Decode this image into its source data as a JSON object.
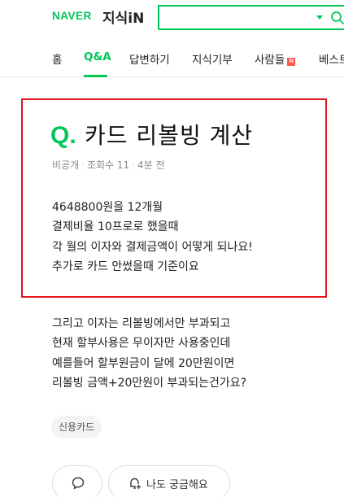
{
  "header": {
    "brand": "NAVER",
    "service": "지식iN",
    "search": {
      "value": "",
      "placeholder": ""
    }
  },
  "nav": {
    "items": [
      {
        "label": "홈"
      },
      {
        "label": "Q&A",
        "active": true
      },
      {
        "label": "답변하기"
      },
      {
        "label": "지식기부"
      },
      {
        "label": "사람들",
        "badge": "N"
      },
      {
        "label": "베스트"
      }
    ]
  },
  "question": {
    "q_mark": "Q.",
    "title": "카드 리볼빙 계산",
    "meta": {
      "author": "비공개",
      "views": "조회수 11",
      "time": "4분 전"
    },
    "body": [
      "4648800원을 12개월",
      "결제비율 10프로로 했을때",
      "각 월의 이자와 결제금액이 어떻게 되나요!",
      "추가로 카드 안썼을때 기준이요"
    ]
  },
  "continued_body": [
    "그리고 이자는 리볼빙에서만 부과되고",
    "현재 할부사용은 무이자만 사용중인데",
    "예를들어 할부원금이 달에 20만원이면",
    "리볼빙 금액+20만원이 부과되는건가요?"
  ],
  "tag": "신용카드",
  "actions": {
    "curious_label": "나도 궁금해요"
  },
  "colors": {
    "brand_green": "#03c75a",
    "highlight_red": "#e3141a",
    "badge_red": "#ff5a4e"
  }
}
